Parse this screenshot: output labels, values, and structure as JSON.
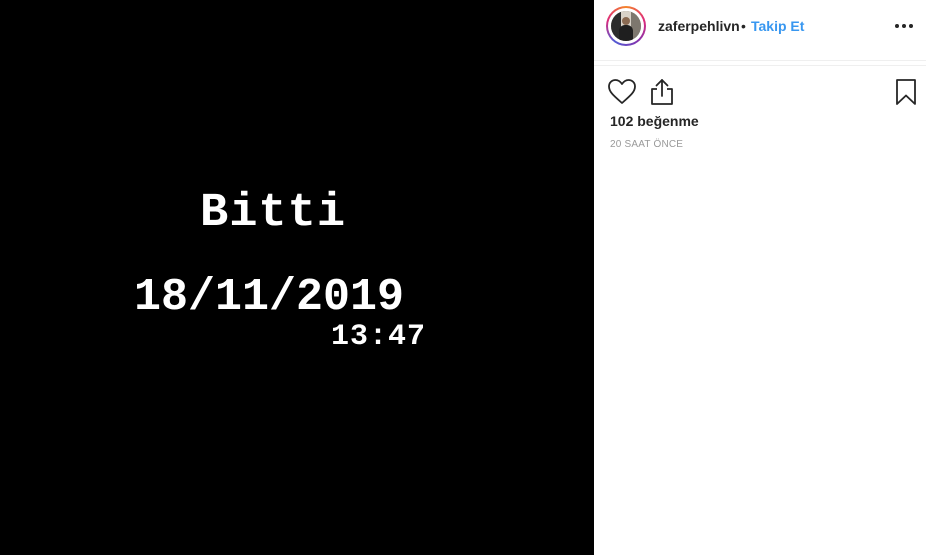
{
  "post": {
    "title": "Bitti",
    "date": "18/11/2019",
    "time": "13:47"
  },
  "header": {
    "username": "zaferpehlivn",
    "separator": "•",
    "follow_label": "Takip Et",
    "more_icon": "more-options-icon"
  },
  "actions": {
    "like_icon": "heart-icon",
    "share_icon": "share-icon",
    "save_icon": "bookmark-icon"
  },
  "stats": {
    "likes": "102 beğenme",
    "timestamp": "20 SAAT ÖNCE"
  },
  "colors": {
    "media_bg": "#000000",
    "follow": "#3897f0",
    "text": "#262626",
    "muted": "#999999"
  }
}
